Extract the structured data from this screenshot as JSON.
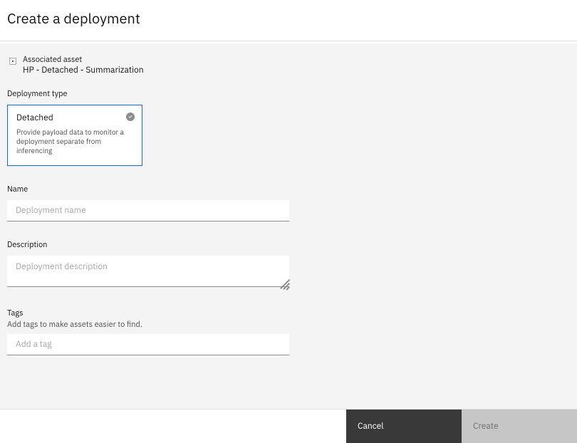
{
  "header": {
    "title": "Create a deployment"
  },
  "associated": {
    "label": "Associated asset",
    "value": "HP - Detached - Summarization"
  },
  "deploymentType": {
    "label": "Deployment type",
    "option": {
      "title": "Detached",
      "description": "Provide payload data to monitor a deployment separate from inferencing"
    }
  },
  "name": {
    "label": "Name",
    "placeholder": "Deployment name"
  },
  "description": {
    "label": "Description",
    "placeholder": "Deployment description"
  },
  "tags": {
    "label": "Tags",
    "helper": "Add tags to make assets easier to find.",
    "placeholder": "Add a tag"
  },
  "footer": {
    "cancel": "Cancel",
    "create": "Create"
  }
}
